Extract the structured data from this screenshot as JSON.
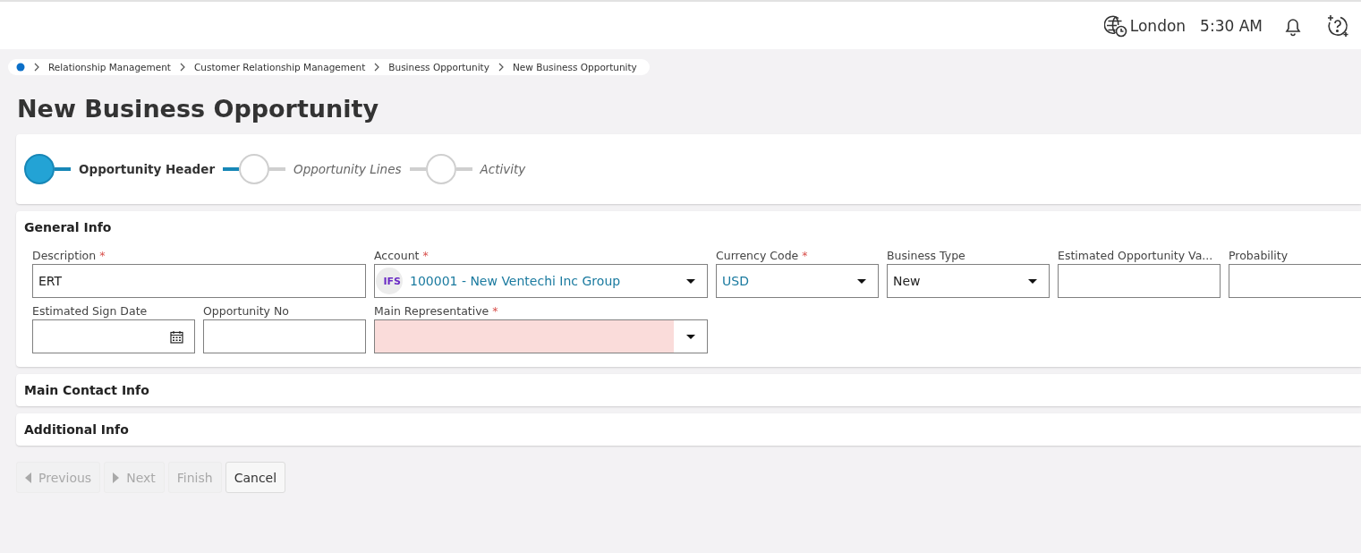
{
  "header": {
    "timezone": "London",
    "time": "5:30 AM"
  },
  "breadcrumb": [
    "Relationship Management",
    "Customer Relationship Management",
    "Business Opportunity",
    "New Business Opportunity"
  ],
  "title": "New Business Opportunity",
  "steps": [
    {
      "label": "Opportunity Header",
      "selected": true
    },
    {
      "label": "Opportunity Lines",
      "selected": false
    },
    {
      "label": "Activity",
      "selected": false
    }
  ],
  "general_info": {
    "title": "General Info",
    "fields": [
      {
        "label": "Description",
        "required_mark": "*",
        "kind": "text",
        "value": "ERT"
      },
      {
        "label": "Account",
        "required_mark": "*",
        "kind": "lookup",
        "value": "100001 - New Ventechi Inc Group",
        "logo_text": "IFS"
      },
      {
        "label": "Currency Code",
        "required_mark": "*",
        "kind": "lookup",
        "value": "USD"
      },
      {
        "label": "Business Type",
        "kind": "select",
        "value": "New"
      },
      {
        "label": "Estimated Opportunity Va...",
        "kind": "text"
      },
      {
        "label": "Probability",
        "kind": "text"
      },
      {
        "label": "Estimated Sign Date",
        "kind": "date"
      },
      {
        "label": "Opportunity No",
        "kind": "text"
      },
      {
        "label": "Main Representative",
        "required_mark": "*",
        "kind": "select",
        "invalid": true
      }
    ]
  },
  "sections": [
    {
      "title": "Main Contact Info"
    },
    {
      "title": "Additional Info"
    }
  ],
  "buttons": [
    {
      "label": "Previous",
      "kind": "previous",
      "disabled": true
    },
    {
      "label": "Next",
      "kind": "next",
      "disabled": true
    },
    {
      "label": "Finish",
      "kind": "plain",
      "disabled": true
    },
    {
      "label": "Cancel",
      "kind": "plain",
      "disabled": false
    }
  ]
}
